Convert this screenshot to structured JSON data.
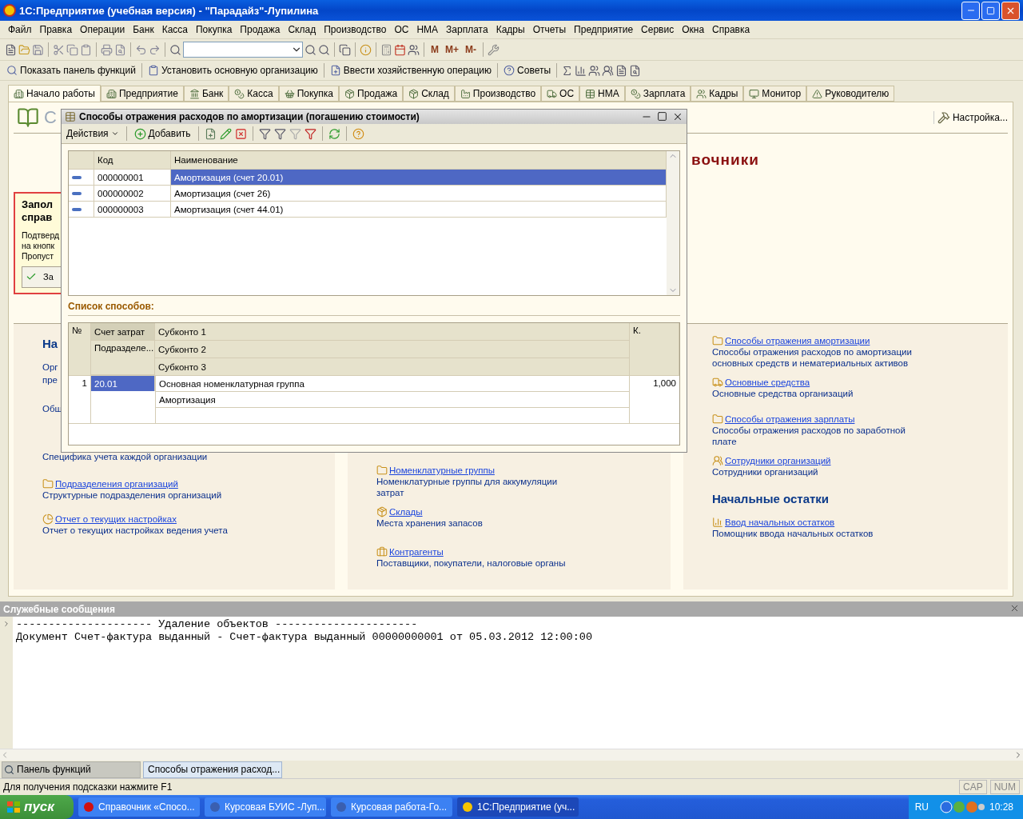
{
  "window": {
    "title": "1С:Предприятие (учебная версия) - \"Парадайз\"-Лупилина"
  },
  "menu": [
    "Файл",
    "Правка",
    "Операции",
    "Банк",
    "Касса",
    "Покупка",
    "Продажа",
    "Склад",
    "Производство",
    "ОС",
    "НМА",
    "Зарплата",
    "Кадры",
    "Отчеты",
    "Предприятие",
    "Сервис",
    "Окна",
    "Справка"
  ],
  "toolbar": {
    "memory_buttons": [
      "M",
      "M+",
      "M-"
    ]
  },
  "function_toolbar": [
    "Показать панель функций",
    "Установить основную организацию",
    "Ввести хозяйственную операцию",
    "Советы"
  ],
  "tabs": [
    {
      "label": "Начало работы",
      "selected": true
    },
    {
      "label": "Предприятие",
      "selected": false
    },
    {
      "label": "Банк",
      "selected": false
    },
    {
      "label": "Касса",
      "selected": false
    },
    {
      "label": "Покупка",
      "selected": false
    },
    {
      "label": "Продажа",
      "selected": false
    },
    {
      "label": "Склад",
      "selected": false
    },
    {
      "label": "Производство",
      "selected": false
    },
    {
      "label": "ОС",
      "selected": false
    },
    {
      "label": "НМА",
      "selected": false
    },
    {
      "label": "Зарплата",
      "selected": false
    },
    {
      "label": "Кадры",
      "selected": false
    },
    {
      "label": "Монитор",
      "selected": false
    },
    {
      "label": "Руководителю",
      "selected": false
    }
  ],
  "panel": {
    "title": "С",
    "settings": "Настройка...",
    "section_heading": "вочники",
    "notice": {
      "title": [
        "Запол",
        "справ"
      ],
      "text": [
        "Подтверд",
        "на кнопк",
        "Пропуст"
      ],
      "button": "За"
    },
    "column_1": {
      "heading": "На",
      "fragments": [
        "Орг",
        "пре",
        "Общ"
      ],
      "items": [
        {
          "description": "Специфика учета каждой организации"
        },
        {
          "link": "Подразделения организаций",
          "description": "Структурные подразделения организаций"
        },
        {
          "link": "Отчет о текущих настройках",
          "description": "Отчет о текущих настройках ведения учета"
        }
      ]
    },
    "column_2": {
      "items": [
        {
          "link": "Номенклатурные группы",
          "description": "Номенклатурные группы для аккумуляции затрат"
        },
        {
          "link": "Склады",
          "description": "Места хранения запасов"
        },
        {
          "link": "Контрагенты",
          "description": "Поставщики, покупатели, налоговые органы"
        }
      ]
    },
    "column_3": {
      "items": [
        {
          "link": "Способы отражения амортизации",
          "description": "Способы отражения расходов по амортизации основных средств и нематериальных активов"
        },
        {
          "link": "Основные средства",
          "description": "Основные средства организаций"
        },
        {
          "link": "Способы отражения зарплаты",
          "description": "Способы отражения расходов по заработной плате"
        },
        {
          "link": "Сотрудники организаций",
          "description": "Сотрудники организаций"
        }
      ],
      "heading": "Начальные остатки",
      "items_2": [
        {
          "link": "Ввод начальных остатков",
          "description": "Помощник ввода начальных остатков"
        }
      ]
    }
  },
  "dialog": {
    "title": "Способы отражения расходов по амортизации (погашению стоимости)",
    "actions": "Действия",
    "add": "Добавить",
    "list": {
      "columns": [
        "Код",
        "Наименование"
      ],
      "rows": [
        {
          "code": "000000001",
          "name": "Амортизация (счет 20.01)",
          "selected": true
        },
        {
          "code": "000000002",
          "name": "Амортизация (счет 26)",
          "selected": false
        },
        {
          "code": "000000003",
          "name": "Амортизация (счет 44.01)",
          "selected": false
        }
      ]
    },
    "section_label": "Список способов:",
    "methods": {
      "columns": {
        "number": "№",
        "account": "Счет затрат",
        "division": "Подразделе...",
        "subconto": [
          "Субконто 1",
          "Субконто 2",
          "Субконто 3"
        ],
        "coefficient": "К."
      },
      "rows": [
        {
          "number": "1",
          "account": "20.01",
          "selected": true,
          "subconto": [
            "Основная номенклатурная группа",
            "Амортизация"
          ],
          "coefficient": "1,000"
        }
      ]
    }
  },
  "messages": {
    "title": "Служебные сообщения",
    "lines": [
      "--------------------- Удаление объектов ----------------------",
      "Документ Счет-фактура выданный - Счет-фактура выданный 00000000001 от 05.03.2012 12:00:00"
    ]
  },
  "window_tabs": [
    {
      "label": "Панель функций",
      "selected": false
    },
    {
      "label": "Способы отражения расход...",
      "selected": true
    }
  ],
  "status_bar": {
    "hint": "Для получения подсказки нажмите F1",
    "indicators": [
      "CAP",
      "NUM"
    ]
  },
  "taskbar": {
    "start": "пуск",
    "tasks": [
      {
        "label": "Справочник «Спосо...",
        "selected": false
      },
      {
        "label": "Курсовая БУИС -Луп...",
        "selected": false
      },
      {
        "label": "Курсовая работа-Го...",
        "selected": false
      },
      {
        "label": "1С:Предприятие (уч...",
        "selected": true
      }
    ],
    "language": "RU",
    "time": "10:28"
  }
}
